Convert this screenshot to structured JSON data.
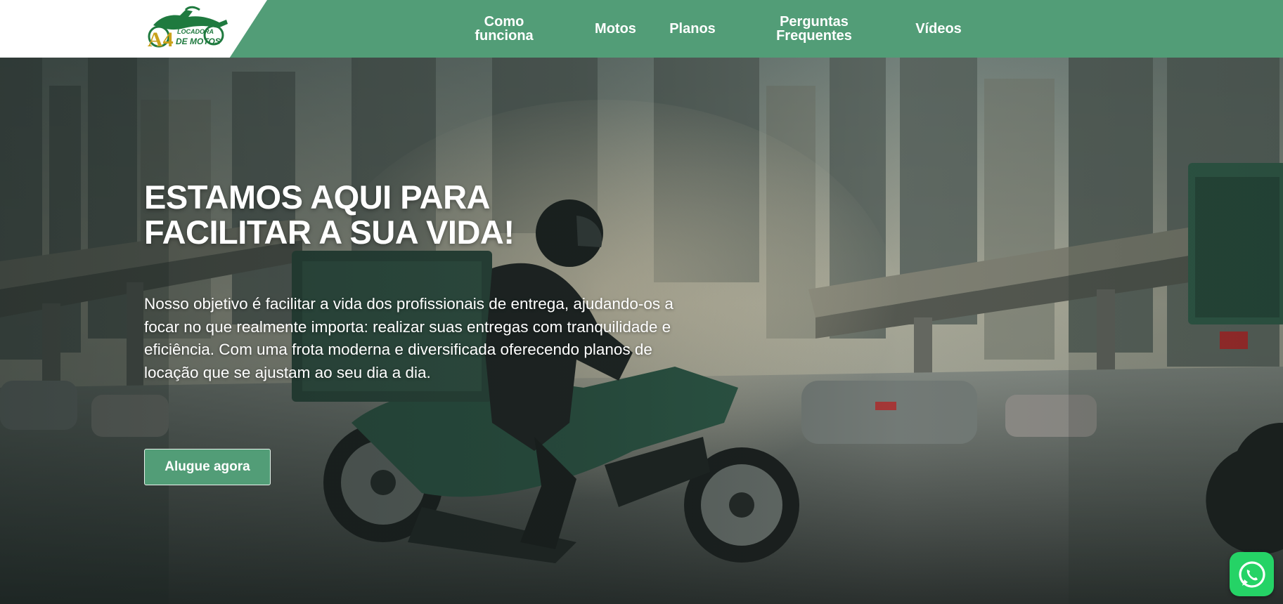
{
  "logo": {
    "mark": "A4",
    "line1": "LOCADORA",
    "line2": "DE MOTOS"
  },
  "nav": {
    "como_funciona": "Como funciona",
    "motos": "Motos",
    "planos": "Planos",
    "perguntas_line1": "Perguntas",
    "perguntas_line2": "Frequentes",
    "videos": "Vídeos"
  },
  "hero": {
    "title_line1": "ESTAMOS AQUI PARA",
    "title_line2": "FACILITAR A SUA VIDA!",
    "description": "Nosso objetivo é facilitar a vida dos profissionais de entrega, ajudando-os a focar no que realmente importa: realizar suas entregas com tranquilidade e eficiência. Com uma frota moderna e diversificada oferecendo planos de locação que se ajustam ao seu dia a dia.",
    "cta_label": "Alugue agora"
  },
  "floating": {
    "whatsapp_icon": "whatsapp-icon"
  },
  "colors": {
    "brand_green": "#529d77",
    "logo_green": "#1f7a3f",
    "logo_gold": "#c9a21b",
    "whatsapp": "#25d366"
  }
}
